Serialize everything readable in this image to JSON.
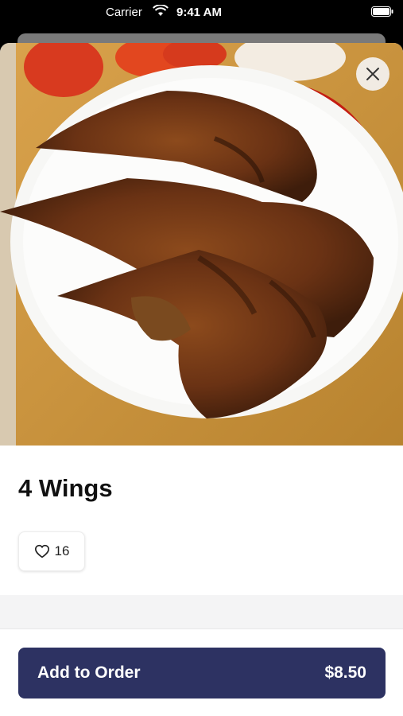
{
  "status_bar": {
    "carrier": "Carrier",
    "time": "9:41 AM"
  },
  "item": {
    "title": "4 Wings",
    "likes": "16"
  },
  "order_button": {
    "label": "Add to Order",
    "price": "$8.50"
  },
  "colors": {
    "button_bg": "#2d3262",
    "button_text": "#ffffff"
  },
  "icons": {
    "close": "close-icon",
    "like": "heart-outline-icon"
  }
}
